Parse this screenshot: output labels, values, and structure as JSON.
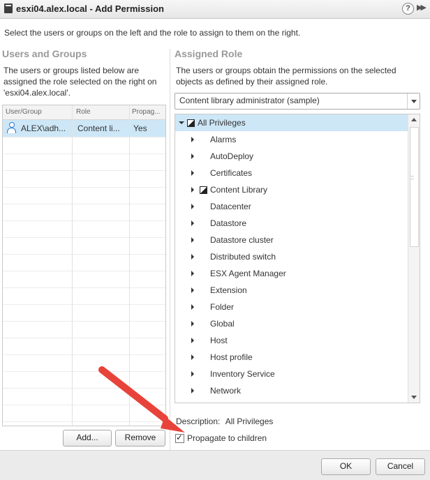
{
  "window": {
    "title": "esxi04.alex.local - Add Permission",
    "help_label": "?",
    "expand_label": "▶▶"
  },
  "instruction": "Select the users or groups on the left and the role to assign to them on the right.",
  "users_groups": {
    "heading": "Users and Groups",
    "description_line1": "The users or groups listed below are",
    "description_line2": "assigned the role selected on the right on",
    "description_line3": "'esxi04.alex.local'.",
    "columns": [
      "User/Group",
      "Role",
      "Propag..."
    ],
    "rows": [
      {
        "user": "ALEX\\adh...",
        "role": "Content li...",
        "propagate": "Yes",
        "icon": "user-icon"
      }
    ],
    "add_button": "Add...",
    "remove_button": "Remove"
  },
  "assigned_role": {
    "heading": "Assigned Role",
    "description_line1": "The users or groups obtain the permissions on the selected",
    "description_line2": "objects as defined by their assigned role.",
    "selected_role": "Content library administrator (sample)",
    "tree": {
      "root": "All Privileges",
      "items": [
        "Alarms",
        "AutoDeploy",
        "Certificates",
        "Content Library",
        "Datacenter",
        "Datastore",
        "Datastore cluster",
        "Distributed switch",
        "ESX Agent Manager",
        "Extension",
        "Folder",
        "Global",
        "Host",
        "Host profile",
        "Inventory Service",
        "Network"
      ],
      "partial_item": "Content Library"
    },
    "description_label": "Description:",
    "description_value": "All Privileges",
    "propagate_label": "Propagate to children",
    "propagate_checked": true
  },
  "footer": {
    "ok_label": "OK",
    "cancel_label": "Cancel"
  },
  "colors": {
    "selection": "#cde7f7",
    "annotation_arrow": "#e8433a",
    "heading_gray": "#999999"
  }
}
